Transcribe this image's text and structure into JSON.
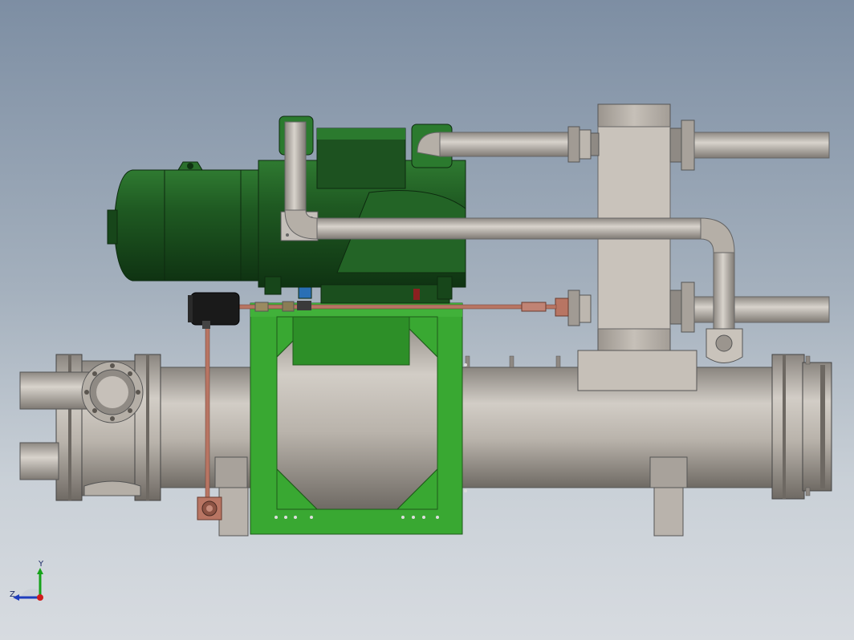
{
  "viewport": {
    "background_top": "#7d8ea3",
    "background_bottom": "#d7dbe0"
  },
  "colors": {
    "compressor_green": "#1f5a22",
    "bracket_green": "#39a832",
    "steel_gray": "#b8b2aa",
    "copper": "#b87563"
  },
  "triad": {
    "y_label": "Y",
    "z_label": "Z"
  }
}
